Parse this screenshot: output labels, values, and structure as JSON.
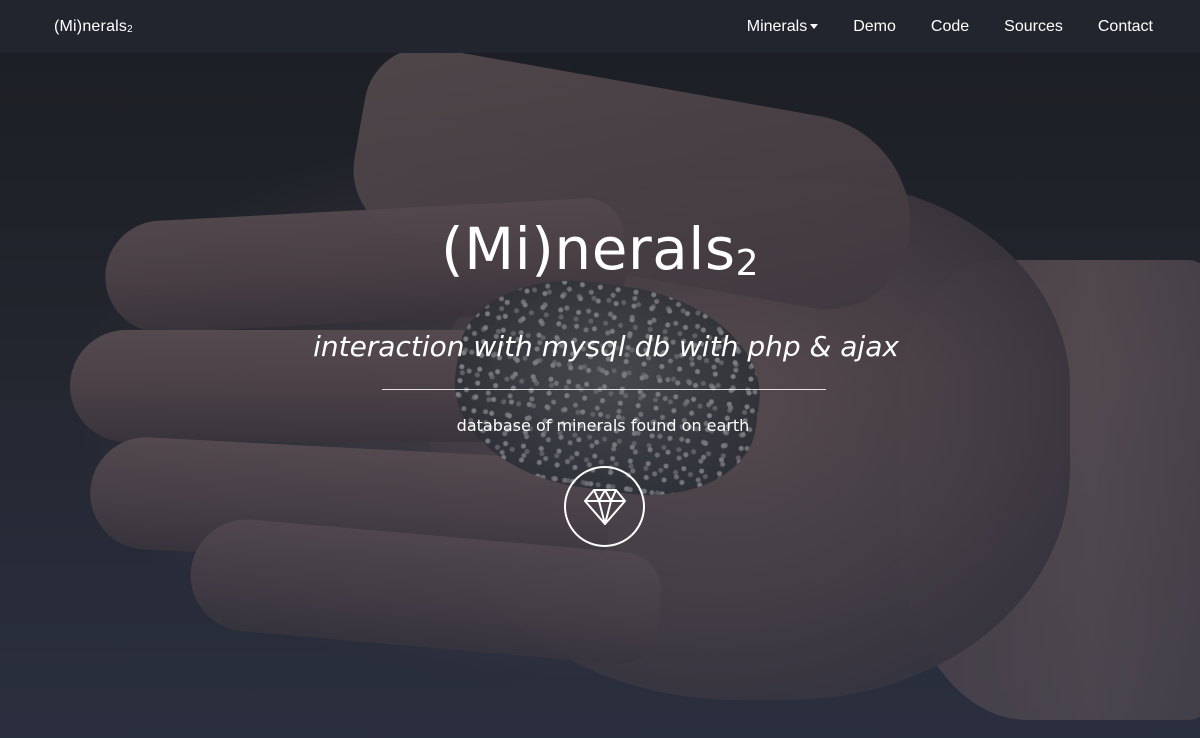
{
  "navbar": {
    "brand": {
      "text": "(Mi)nerals",
      "subscript": "2"
    },
    "items": [
      {
        "label": "Minerals",
        "has_dropdown": true
      },
      {
        "label": "Demo"
      },
      {
        "label": "Code"
      },
      {
        "label": "Sources"
      },
      {
        "label": "Contact"
      }
    ]
  },
  "hero": {
    "title": {
      "text": "(Mi)nerals",
      "subscript": "2"
    },
    "tagline": "interaction with mysql db with php & ajax",
    "subtitle": "database of minerals found on earth",
    "cta_icon": "diamond-icon"
  },
  "colors": {
    "navbar_bg": "#22252e",
    "text": "#ffffff"
  }
}
